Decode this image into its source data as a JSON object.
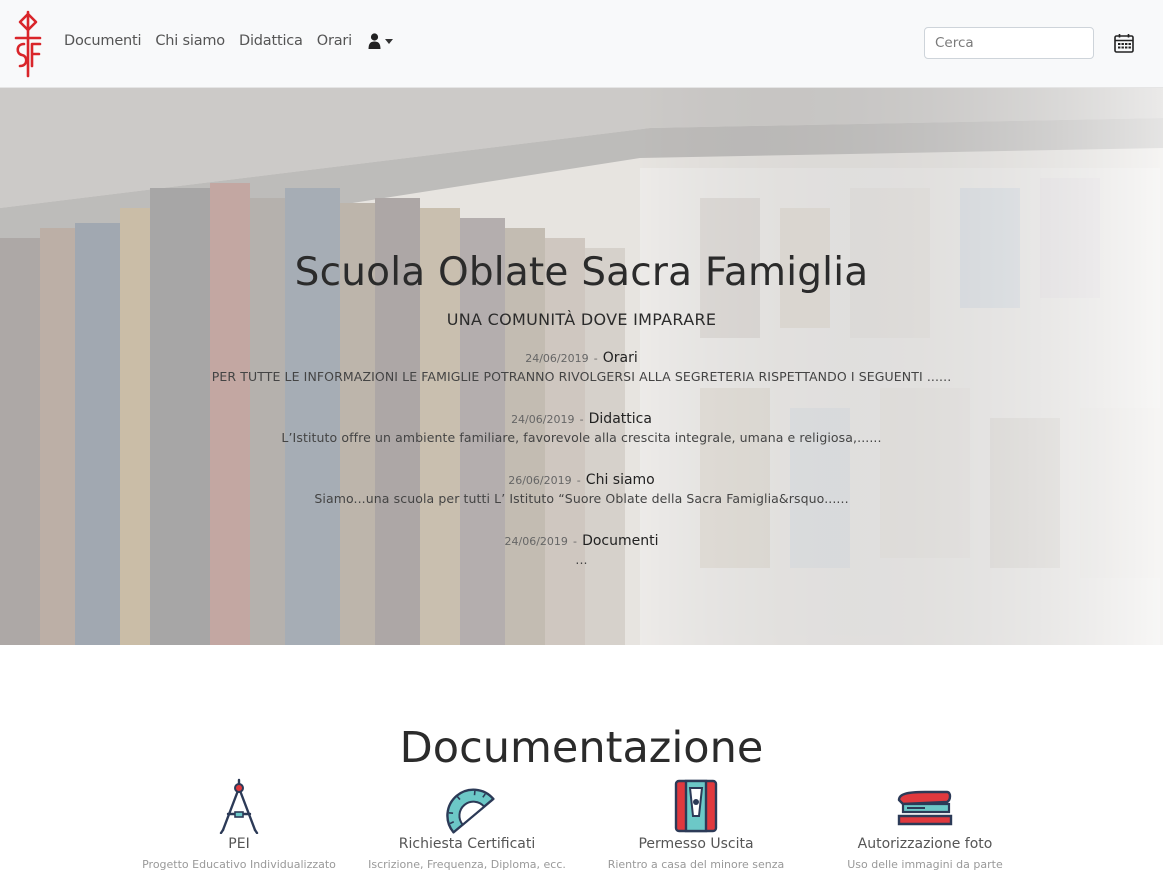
{
  "nav": {
    "links": [
      "Documenti",
      "Chi siamo",
      "Didattica",
      "Orari"
    ],
    "user_icon": "user-icon",
    "search_placeholder": "Cerca",
    "calendar_icon": "calendar-icon"
  },
  "hero": {
    "title": "Scuola Oblate Sacra Famiglia",
    "subtitle": "UNA COMUNITÀ DOVE IMPARARE",
    "news": [
      {
        "date": "24/06/2019",
        "title": "Orari",
        "body": "PER TUTTE LE INFORMAZIONI LE FAMIGLIE POTRANNO RIVOLGERSI ALLA SEGRETERIA RISPETTANDO I SEGUENTI ......"
      },
      {
        "date": "24/06/2019",
        "title": "Didattica",
        "body": "L’Istituto offre un ambiente familiare, favorevole alla crescita integrale, umana e religiosa,......"
      },
      {
        "date": "26/06/2019",
        "title": "Chi siamo",
        "body": "Siamo...una scuola per tutti L’ Istituto “Suore Oblate della Sacra Famiglia&rsquo......"
      },
      {
        "date": "24/06/2019",
        "title": "Documenti",
        "body": "..."
      }
    ],
    "separator": "-"
  },
  "documentation": {
    "title": "Documentazione",
    "items": [
      {
        "label": "PEI",
        "desc": "Progetto Educativo Individualizzato",
        "icon": "compass-icon"
      },
      {
        "label": "Richiesta Certificati",
        "desc": "Iscrizione, Frequenza, Diploma, ecc.",
        "icon": "protractor-icon"
      },
      {
        "label": "Permesso Uscita",
        "desc": "Rientro a casa del minore senza",
        "icon": "sharpener-icon"
      },
      {
        "label": "Autorizzazione foto",
        "desc": "Uso delle immagini da parte",
        "icon": "stapler-icon"
      }
    ]
  },
  "colors": {
    "logo_red": "#d9252a",
    "icon_navy": "#2c3a57",
    "icon_teal": "#6cc8c7",
    "icon_red": "#e0393e"
  }
}
